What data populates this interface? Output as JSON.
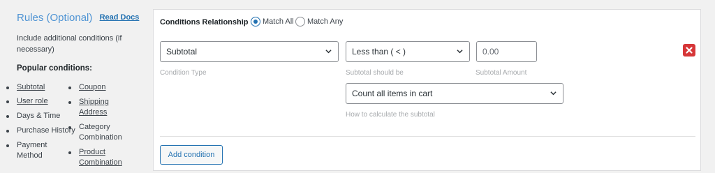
{
  "help": {
    "title": "Rules (Optional)",
    "read_docs": "Read Docs",
    "description": "Include additional conditions (if necessary)",
    "popular_label": "Popular conditions:",
    "conditions_col1": [
      "Subtotal",
      "User role",
      "Days & Time",
      "Purchase History",
      "Payment Method"
    ],
    "conditions_col2": [
      "Coupon",
      "Shipping Address",
      "Category Combination",
      "Product Combination"
    ]
  },
  "relationship": {
    "label": "Conditions Relationship",
    "options": [
      "Match All",
      "Match Any"
    ],
    "selected": "Match All"
  },
  "condition_row": {
    "type_value": "Subtotal",
    "type_hint": "Condition Type",
    "operator_value": "Less than ( < )",
    "operator_hint": "Subtotal should be",
    "amount_value": "0.00",
    "amount_hint": "Subtotal Amount",
    "calc_value": "Count all items in cart",
    "calc_hint": "How to calculate the subtotal"
  },
  "add_condition_label": "Add condition",
  "colors": {
    "accent": "#2271b1",
    "title": "#4f94d4",
    "danger": "#d63638"
  },
  "icons": {
    "remove": "close-icon",
    "dropdown": "chevron-down-icon"
  }
}
